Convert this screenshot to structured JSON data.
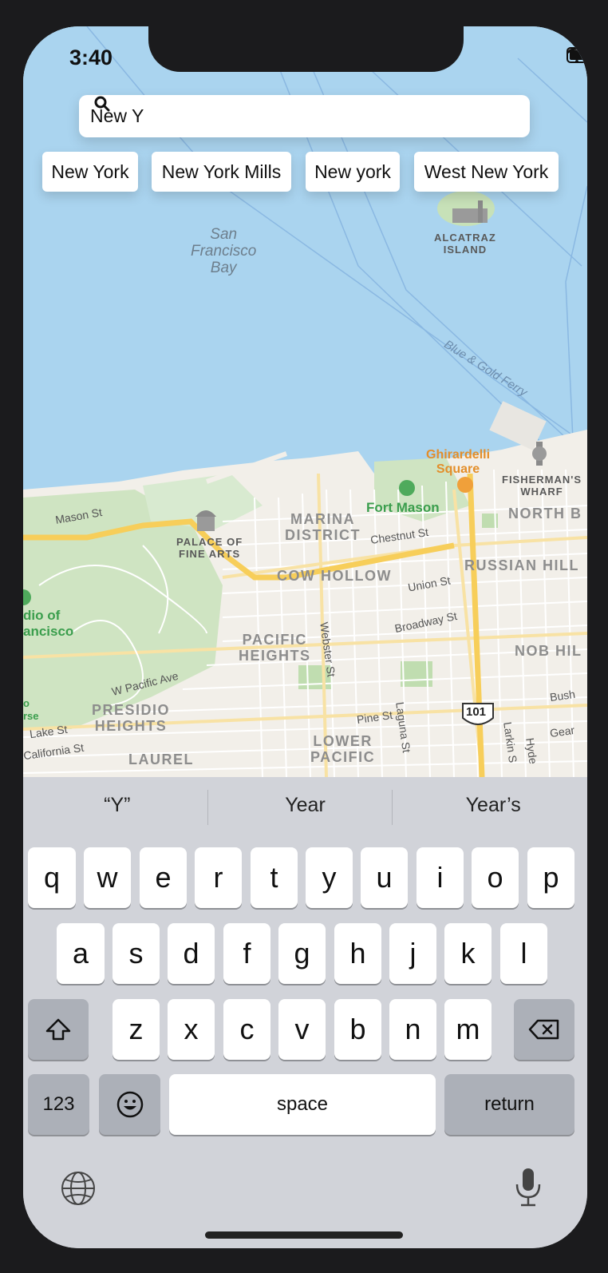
{
  "status": {
    "time": "3:40"
  },
  "search": {
    "value": "New Y"
  },
  "suggestions_chips": [
    "New York",
    "New York Mills",
    "New york",
    "West New York"
  ],
  "map_labels": {
    "bay": "San\nFrancisco\nBay",
    "alcatraz": "ALCATRAZ\nISLAND",
    "ferry": "Blue & Gold Ferry",
    "ghirardelli": "Ghirardelli\nSquare",
    "fishermans": "FISHERMAN'S\nWHARF",
    "fort_mason": "Fort Mason",
    "marina": "MARINA\nDISTRICT",
    "north_beach": "NORTH B",
    "palace": "PALACE OF\nFINE ARTS",
    "cow_hollow": "COW HOLLOW",
    "russian_hill": "RUSSIAN HILL",
    "pacific_heights": "PACIFIC\nHEIGHTS",
    "nob_hill": "NOB HIL",
    "presidio_heights": "PRESIDIO\nHEIGHTS",
    "lower_pacific": "LOWER\nPACIFIC",
    "laurel": "LAUREL",
    "presidio": "dio of\nancisco",
    "mason_st": "Mason St",
    "chestnut_st": "Chestnut St",
    "union_st": "Union St",
    "broadway_st": "Broadway St",
    "webster_st": "Webster St",
    "w_pacific_ave": "W Pacific Ave",
    "pine_st": "Pine St",
    "laguna_st": "Laguna St",
    "larkin_st": "Larkin S",
    "hyde": "Hyde",
    "bush": "Bush",
    "geary": "Gear",
    "lake_st": "Lake St",
    "california_st": "California St",
    "highway": "101",
    "se": "o\nrse"
  },
  "keyboard": {
    "predictions": [
      "“Y”",
      "Year",
      "Year’s"
    ],
    "row1": [
      "q",
      "w",
      "e",
      "r",
      "t",
      "y",
      "u",
      "i",
      "o",
      "p"
    ],
    "row2": [
      "a",
      "s",
      "d",
      "f",
      "g",
      "h",
      "j",
      "k",
      "l"
    ],
    "row3": [
      "z",
      "x",
      "c",
      "v",
      "b",
      "n",
      "m"
    ],
    "numbers_label": "123",
    "space_label": "space",
    "return_label": "return"
  },
  "icons": [
    "search-icon",
    "wifi-icon",
    "battery-icon",
    "shift-icon",
    "delete-icon",
    "emoji-icon",
    "globe-icon",
    "microphone-icon"
  ]
}
